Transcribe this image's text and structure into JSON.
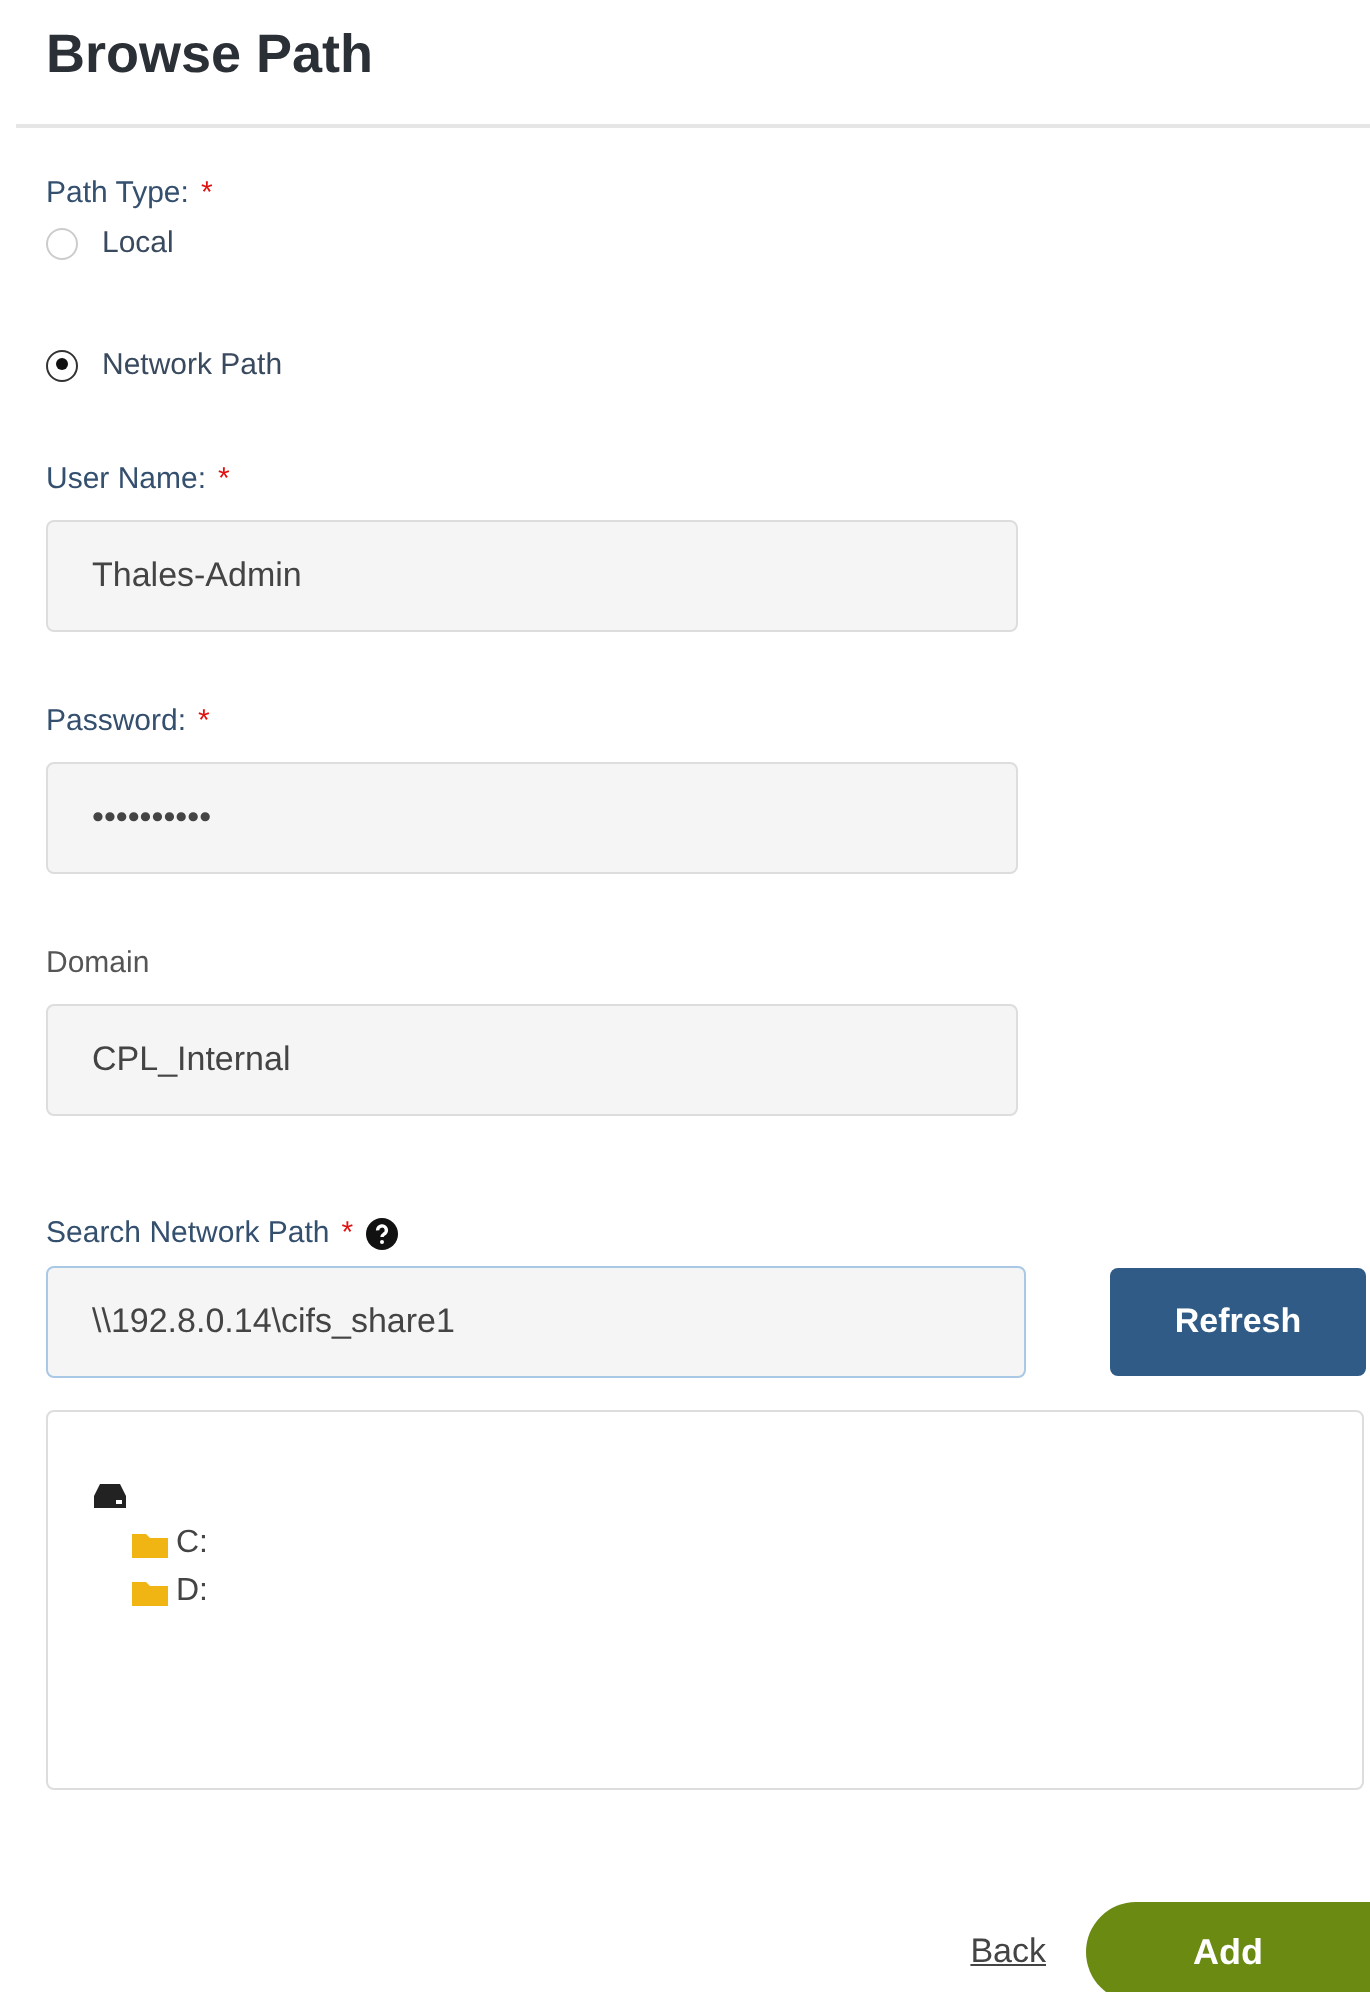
{
  "title": "Browse Path",
  "path_type": {
    "label": "Path Type:",
    "required_mark": "*",
    "options": [
      {
        "label": "Local",
        "selected": false
      },
      {
        "label": "Network Path",
        "selected": true
      }
    ]
  },
  "fields": [
    {
      "label": "User Name:",
      "required_mark": "*",
      "value": "Thales-Admin"
    },
    {
      "label": "Password:",
      "required_mark": "*",
      "value": "••••••••••"
    },
    {
      "label": "Domain",
      "value": "CPL_Internal"
    }
  ],
  "search": {
    "label": "Search Network Path",
    "required_mark": "*",
    "help": true,
    "value": "\\\\192.8.0.14\\cifs_share1",
    "focused": true,
    "button": "Refresh"
  },
  "tree": [
    {
      "kind": "drive",
      "children": [
        {
          "kind": "folder",
          "label": "C:"
        },
        {
          "kind": "folder",
          "label": "D:"
        }
      ]
    }
  ],
  "footer": {
    "back": "Back",
    "add": "Add"
  }
}
